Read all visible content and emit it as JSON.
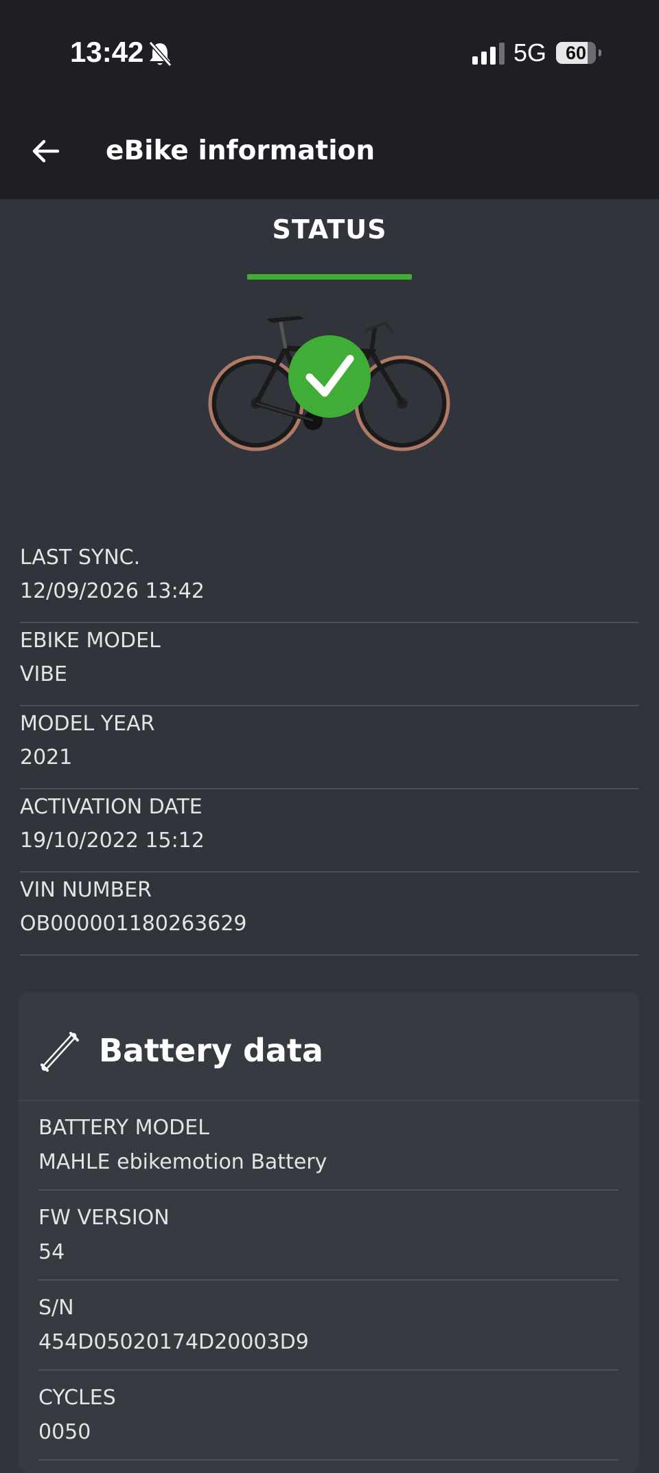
{
  "status_bar": {
    "time": "13:42",
    "network": "5G",
    "battery_level": "60",
    "icons": [
      "bell-slash-icon",
      "cellular-signal-icon",
      "battery-icon"
    ]
  },
  "app_bar": {
    "title": "eBike information",
    "back_icon": "arrow-left-icon"
  },
  "tabs": [
    {
      "label": "STATUS",
      "active": true,
      "accent": "#3fad36"
    }
  ],
  "bike_status": {
    "icon": "check-circle-icon",
    "color": "#3fad36"
  },
  "info": [
    {
      "label": "LAST SYNC.",
      "value": "12/09/2026 13:42"
    },
    {
      "label": "EBIKE MODEL",
      "value": "VIBE"
    },
    {
      "label": "MODEL YEAR",
      "value": "2021"
    },
    {
      "label": "ACTIVATION DATE",
      "value": "19/10/2022 15:12"
    },
    {
      "label": "VIN NUMBER",
      "value": "OB000001180263629"
    }
  ],
  "battery_card": {
    "title": "Battery data",
    "icon": "battery-tube-icon",
    "rows": [
      {
        "label": "BATTERY MODEL",
        "value": "MAHLE ebikemotion Battery"
      },
      {
        "label": "FW VERSION",
        "value": "54"
      },
      {
        "label": "S/N",
        "value": "454D05020174D20003D9"
      },
      {
        "label": "CYCLES",
        "value": "0050"
      }
    ]
  }
}
